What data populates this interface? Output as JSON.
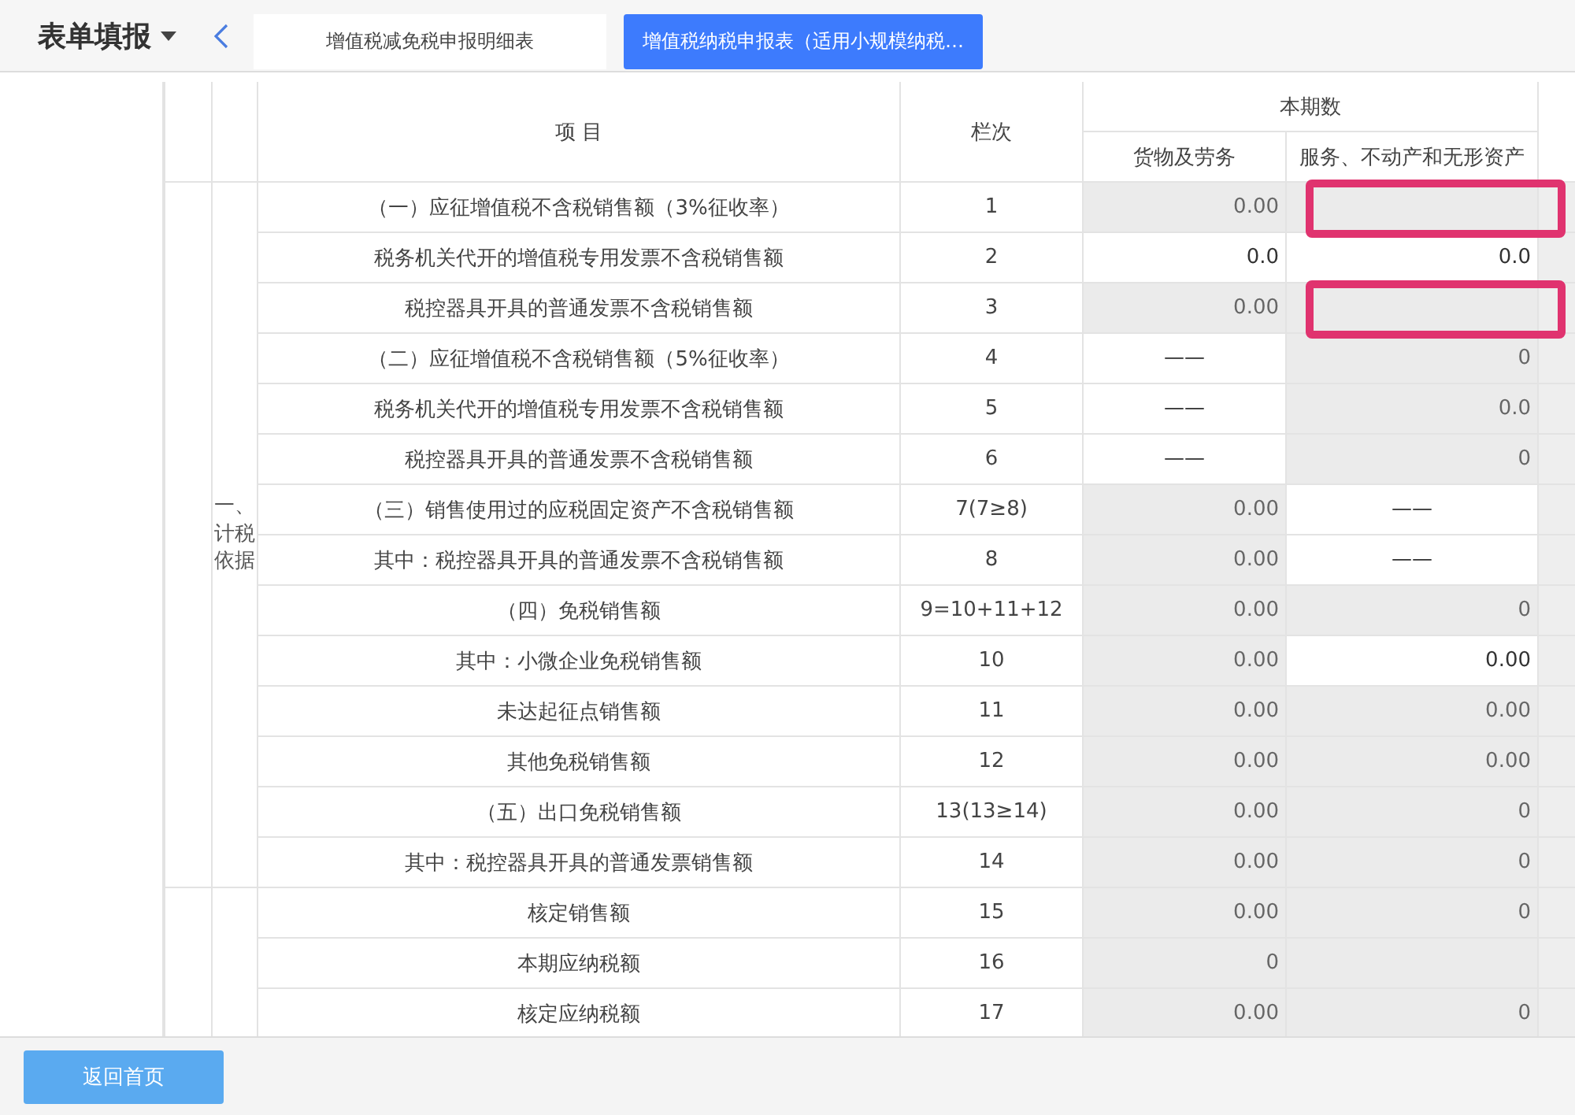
{
  "header": {
    "title": "表单填报",
    "tabs": [
      {
        "label": "增值税减免税申报明细表",
        "selected": false
      },
      {
        "label": "增值税纳税申报表（适用小规模纳税…",
        "selected": true
      }
    ]
  },
  "table": {
    "columns": {
      "item": "项 目",
      "line": "栏次",
      "period": "本期数",
      "goods": "货物及劳务",
      "services": "服务、不动产和无形资产"
    },
    "sections": [
      {
        "label": "一、计税依据",
        "rows": [
          {
            "item": "（一）应征增值税不含税销售额（3%征收率）",
            "line": "1",
            "goods": {
              "value": "0.00",
              "readonly": true
            },
            "services": {
              "readonly": true,
              "highlighted": true
            }
          },
          {
            "item": "税务机关代开的增值税专用发票不含税销售额",
            "line": "2",
            "goods": {
              "value": "0.0",
              "readonly": false
            },
            "services": {
              "value": "0.0",
              "readonly": false
            }
          },
          {
            "item": "税控器具开具的普通发票不含税销售额",
            "line": "3",
            "goods": {
              "value": "0.00",
              "readonly": true
            },
            "services": {
              "readonly": true,
              "highlighted": true
            }
          },
          {
            "item": "（二）应征增值税不含税销售额（5%征收率）",
            "line": "4",
            "goods": {
              "value": "——",
              "readonly": false
            },
            "services": {
              "value": "0",
              "readonly": true
            }
          },
          {
            "item": "税务机关代开的增值税专用发票不含税销售额",
            "line": "5",
            "goods": {
              "value": "——",
              "readonly": false
            },
            "services": {
              "value": "0.0",
              "readonly": true
            }
          },
          {
            "item": "税控器具开具的普通发票不含税销售额",
            "line": "6",
            "goods": {
              "value": "——",
              "readonly": false
            },
            "services": {
              "value": "0",
              "readonly": true
            }
          },
          {
            "item": "（三）销售使用过的应税固定资产不含税销售额",
            "line": "7(7≥8)",
            "goods": {
              "value": "0.00",
              "readonly": true
            },
            "services": {
              "value": "——",
              "readonly": false
            }
          },
          {
            "item": "其中：税控器具开具的普通发票不含税销售额",
            "line": "8",
            "goods": {
              "value": "0.00",
              "readonly": true
            },
            "services": {
              "value": "——",
              "readonly": false
            }
          },
          {
            "item": "（四）免税销售额",
            "line": "9=10+11+12",
            "goods": {
              "value": "0.00",
              "readonly": true
            },
            "services": {
              "value": "0",
              "readonly": true
            }
          },
          {
            "item": "其中：小微企业免税销售额",
            "line": "10",
            "goods": {
              "value": "0.00",
              "readonly": true
            },
            "services": {
              "value": "0.00",
              "readonly": false
            }
          },
          {
            "item": "未达起征点销售额",
            "line": "11",
            "goods": {
              "value": "0.00",
              "readonly": true
            },
            "services": {
              "value": "0.00",
              "readonly": true
            }
          },
          {
            "item": "其他免税销售额",
            "line": "12",
            "goods": {
              "value": "0.00",
              "readonly": true
            },
            "services": {
              "value": "0.00",
              "readonly": true
            }
          },
          {
            "item": "（五）出口免税销售额",
            "line": "13(13≥14)",
            "goods": {
              "value": "0.00",
              "readonly": true
            },
            "services": {
              "value": "0",
              "readonly": true
            }
          },
          {
            "item": "其中：税控器具开具的普通发票销售额",
            "line": "14",
            "goods": {
              "value": "0.00",
              "readonly": true
            },
            "services": {
              "value": "0",
              "readonly": true
            }
          }
        ]
      },
      {
        "rows": [
          {
            "item": "核定销售额",
            "line": "15",
            "goods": {
              "value": "0.00",
              "readonly": true
            },
            "services": {
              "value": "0",
              "readonly": true
            }
          },
          {
            "item": "本期应纳税额",
            "line": "16",
            "goods": {
              "value": "0",
              "readonly": true
            },
            "services": {
              "readonly": true
            }
          },
          {
            "item": "核定应纳税额",
            "line": "17",
            "goods": {
              "value": "0.00",
              "readonly": true
            },
            "services": {
              "value": "0",
              "readonly": true
            }
          }
        ]
      }
    ]
  },
  "footer": {
    "button": "返回首页"
  }
}
